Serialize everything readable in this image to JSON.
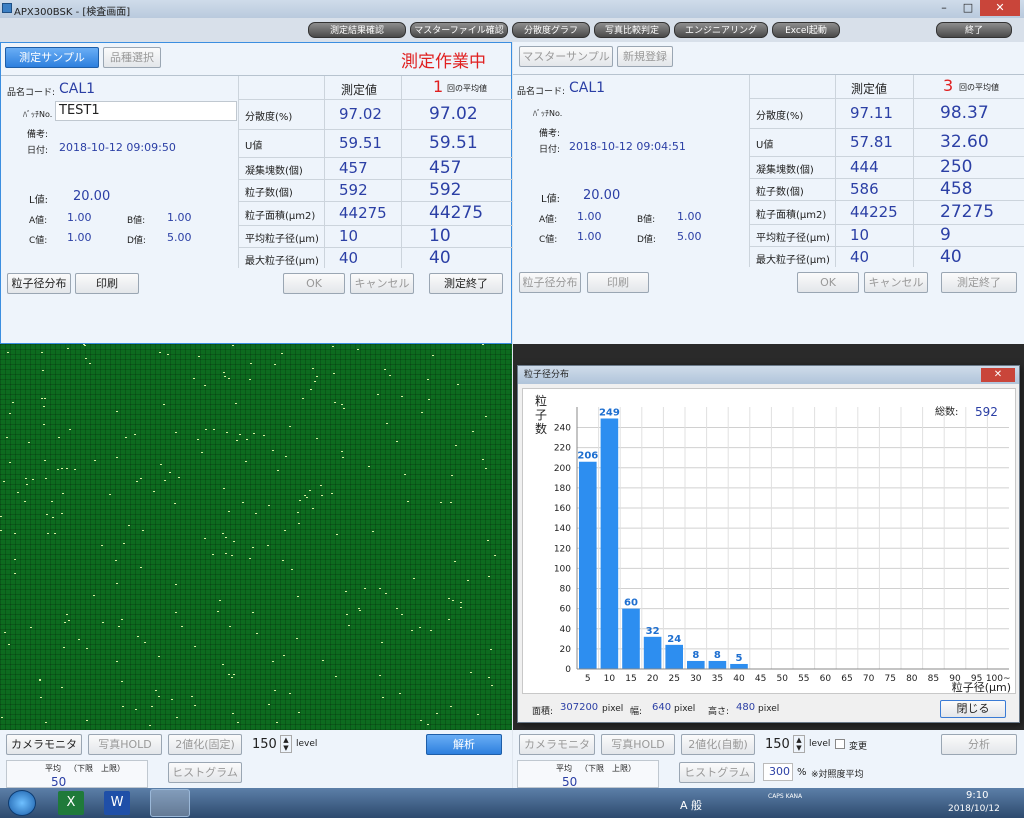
{
  "window": {
    "title": "APX300BSK - [検査画面]",
    "minimize": "–",
    "maximize": "□",
    "close": "✕"
  },
  "menu": [
    "測定結果確認",
    "マスターファイル確認",
    "分散度グラフ",
    "写真比較判定",
    "エンジニアリング",
    "Excel起動",
    "終了"
  ],
  "left": {
    "tab_sample": "測定サンプル",
    "tab_select": "品種選択",
    "status": "測定作業中",
    "code_label": "品名コード:",
    "code": "CAL1",
    "batch_label": "ﾊﾞｯﾁNo.",
    "batch": "TEST1",
    "memo_label": "備考:",
    "date_label": "日付:",
    "date": "2018-10-12 09:09:50",
    "L_label": "L値:",
    "L": "20.00",
    "A_label": "A値:",
    "A": "1.00",
    "B_label": "B値:",
    "B": "1.00",
    "C_label": "C値:",
    "C": "1.00",
    "D_label": "D値:",
    "D": "5.00",
    "col_measure": "測定値",
    "count": "1",
    "count_suffix": "回の平均値",
    "rows": [
      {
        "label": "分散度(%)",
        "m": "97.02",
        "a": "97.02"
      },
      {
        "label": "U値",
        "m": "59.51",
        "a": "59.51"
      },
      {
        "label": "凝集塊数(個)",
        "m": "457",
        "a": "457"
      },
      {
        "label": "粒子数(個)",
        "m": "592",
        "a": "592"
      },
      {
        "label": "粒子面積(μm2)",
        "m": "44275",
        "a": "44275"
      },
      {
        "label": "平均粒子径(μm)",
        "m": "10",
        "a": "10"
      },
      {
        "label": "最大粒子径(μm)",
        "m": "40",
        "a": "40"
      }
    ],
    "btn_dist": "粒子径分布",
    "btn_print": "印刷",
    "btn_ok": "OK",
    "btn_cancel": "キャンセル",
    "btn_end": "測定終了",
    "cam": "カメラモニター",
    "hold": "写真HOLD",
    "binar": "2値化(固定)",
    "level": "150",
    "level_unit": "level",
    "analyze": "解析",
    "avg": "平均",
    "upper": "（下限　上限）",
    "hist": "ヒストグラム",
    "bot_val": "50"
  },
  "right": {
    "tab_master": "マスターサンプル",
    "tab_new": "新規登録",
    "code_label": "品名コード:",
    "code": "CAL1",
    "batch_label": "ﾊﾞｯﾁNo.",
    "memo_label": "備考:",
    "date_label": "日付:",
    "date": "2018-10-12 09:04:51",
    "L_label": "L値:",
    "L": "20.00",
    "A_label": "A値:",
    "A": "1.00",
    "B_label": "B値:",
    "B": "1.00",
    "C_label": "C値:",
    "C": "1.00",
    "D_label": "D値:",
    "D": "5.00",
    "col_measure": "測定値",
    "count": "3",
    "count_suffix": "回の平均値",
    "rows": [
      {
        "label": "分散度(%)",
        "m": "97.11",
        "a": "98.37"
      },
      {
        "label": "U値",
        "m": "57.81",
        "a": "32.60"
      },
      {
        "label": "凝集塊数(個)",
        "m": "444",
        "a": "250"
      },
      {
        "label": "粒子数(個)",
        "m": "586",
        "a": "458"
      },
      {
        "label": "粒子面積(μm2)",
        "m": "44225",
        "a": "27275"
      },
      {
        "label": "平均粒子径(μm)",
        "m": "10",
        "a": "9"
      },
      {
        "label": "最大粒子径(μm)",
        "m": "40",
        "a": "40"
      }
    ],
    "btn_dist": "粒子径分布",
    "btn_print": "印刷",
    "btn_ok": "OK",
    "btn_cancel": "キャンセル",
    "btn_end": "測定終了",
    "cam": "カメラモニター",
    "hold": "写真HOLD",
    "binar": "2値化(自動)",
    "level": "150",
    "level_unit": "level",
    "change": "変更",
    "analyze": "分析",
    "avg": "平均",
    "upper": "（下限　上限）",
    "hist": "ヒストグラム",
    "percent": "300",
    "pct_unit": "%",
    "contrast": "※対照度平均",
    "bot_val": "50"
  },
  "dialog": {
    "title": "粒子径分布",
    "close": "閉じる",
    "total_label": "総数:",
    "total": "592",
    "area_label": "面積:",
    "area": "307200",
    "width_label": "幅:",
    "width": "640",
    "height_label": "高さ:",
    "height": "480",
    "unit": "pixel"
  },
  "chart_data": {
    "type": "bar",
    "ylabel": "粒子数",
    "xlabel": "粒子径(μm)",
    "categories": [
      "5",
      "10",
      "15",
      "20",
      "25",
      "30",
      "35",
      "40",
      "45",
      "50",
      "55",
      "60",
      "65",
      "70",
      "75",
      "80",
      "85",
      "90",
      "95",
      "100~"
    ],
    "values": [
      206,
      249,
      60,
      32,
      24,
      8,
      8,
      5,
      0,
      0,
      0,
      0,
      0,
      0,
      0,
      0,
      0,
      0,
      0,
      0
    ],
    "labels": [
      "206",
      "249",
      "60",
      "32",
      "24",
      "8",
      "8",
      "5"
    ],
    "ylim": [
      0,
      250
    ],
    "yticks": [
      "0",
      "20",
      "40",
      "60",
      "80",
      "100",
      "120",
      "140",
      "160",
      "180",
      "200",
      "220",
      "240"
    ],
    "grid": true,
    "bar_color": "#2d8ef0"
  },
  "taskbar": {
    "time": "9:10",
    "date": "2018/10/12",
    "ime": "A 般",
    "caps": "CAPS KANA"
  }
}
